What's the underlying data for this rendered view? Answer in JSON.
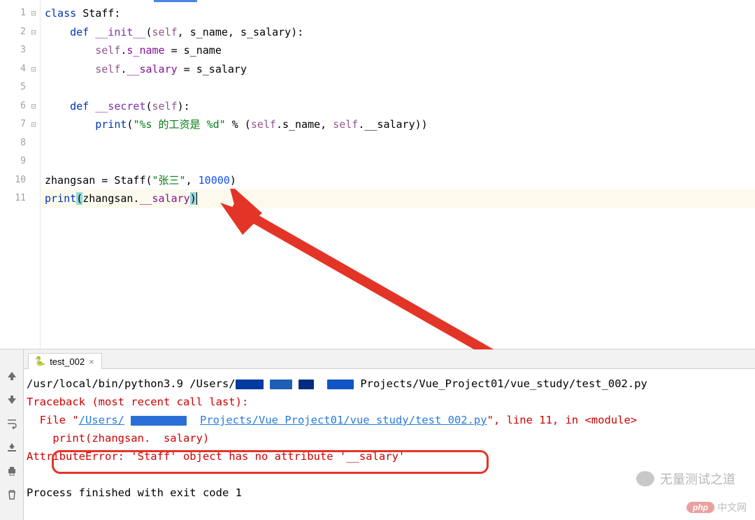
{
  "code": {
    "lines": {
      "1": {
        "kw": "class",
        "name": "Staff",
        "colon": ":"
      },
      "2": {
        "kw": "def",
        "fn": "__init__",
        "params_open": "(",
        "self": "self",
        "p1": ", s_name, s_salary",
        "params_close": "):"
      },
      "3": {
        "self": "self",
        "dot": ".",
        "attr": "s_name",
        "eq": " = s_name"
      },
      "4": {
        "self": "self",
        "dot": ".",
        "attr": "__salary",
        "eq": " = s_salary"
      },
      "6": {
        "kw": "def",
        "fn": "__secret",
        "params_open": "(",
        "self": "self",
        "params_close": "):"
      },
      "7": {
        "bi": "print",
        "open": "(",
        "str": "\"%s 的工资是 %d\"",
        "mid": " % (",
        "self1": "self",
        "a1": ".s_name, ",
        "self2": "self",
        "a2": ".__salary))"
      },
      "10": {
        "var": "zhangsan = Staff(",
        "str": "\"张三\"",
        "comma": ", ",
        "num": "10000",
        "close": ")"
      },
      "11": {
        "bi": "print",
        "open": "(",
        "arg": "zhangsan.",
        "attr": "__salary",
        "close": ")"
      }
    }
  },
  "run": {
    "tab": "test_002",
    "line1_a": "/usr/local/bin/python3.9 /Users/",
    "line1_b": "Projects/Vue_Project01/vue_study/test_002.py",
    "traceback": "Traceback (most recent call last):",
    "file_a": "  File \"",
    "file_link": "/Users/",
    "file_link2": "Projects/Vue Project01/vue study/test 002.py",
    "file_b": "\", line 11, in <module>",
    "print_line": "    print(zhangsan.  salary)",
    "error": "AttributeError: 'Staff' object has no attribute '__salary'",
    "exit": "Process finished with exit code 1"
  },
  "watermark": "无量测试之道",
  "php_badge": {
    "pill": "php",
    "text": "中文网"
  }
}
